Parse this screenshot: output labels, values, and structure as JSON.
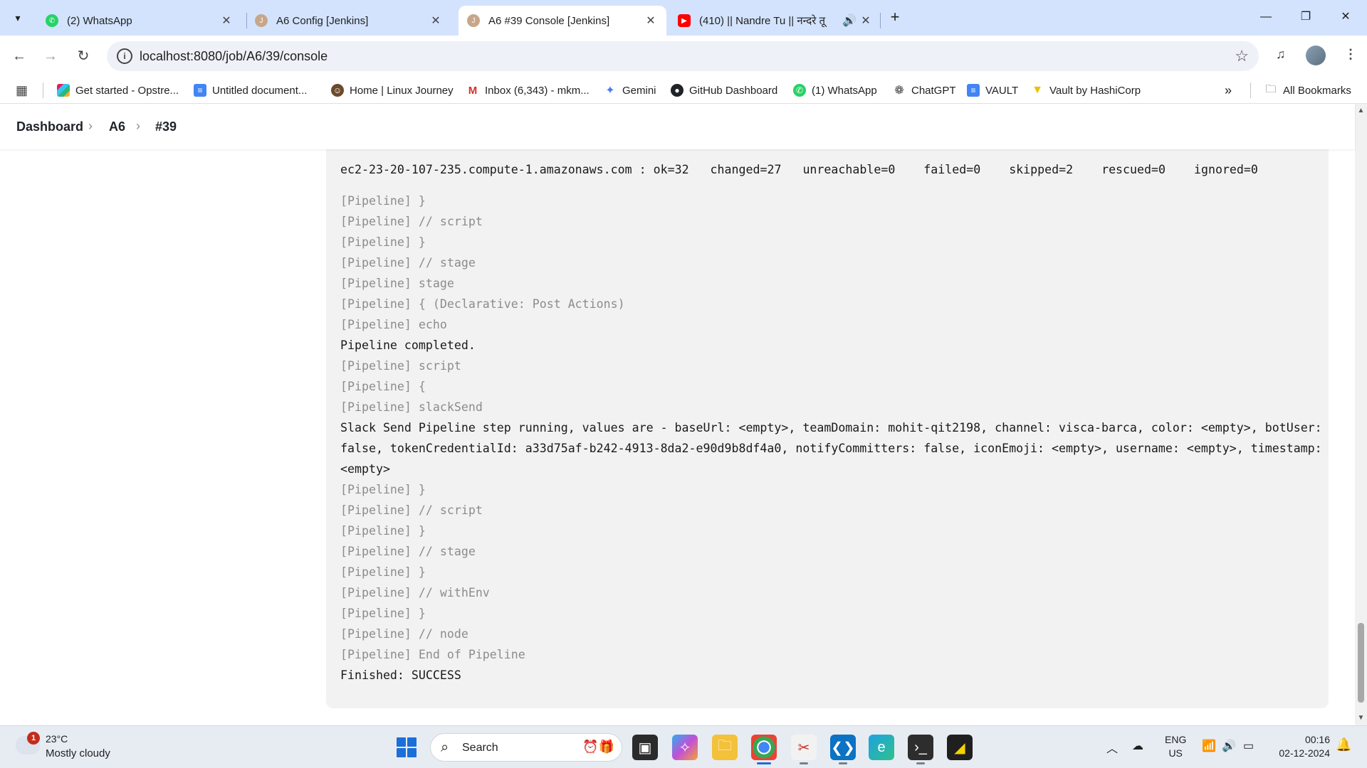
{
  "browser": {
    "tabs": [
      {
        "title": "(2) WhatsApp",
        "icon": "whatsapp-icon"
      },
      {
        "title": "A6 Config [Jenkins]",
        "icon": "jenkins-icon"
      },
      {
        "title": "A6 #39 Console [Jenkins]",
        "icon": "jenkins-icon",
        "active": true
      },
      {
        "title": "(410) || Nandre Tu || नन्दरे तू",
        "icon": "youtube-icon"
      }
    ],
    "url": "localhost:8080/job/A6/39/console",
    "bookmarks": [
      "Get started - Opstre...",
      "Untitled document...",
      "Home | Linux Journey",
      "Inbox (6,343) - mkm...",
      "Gemini",
      "GitHub Dashboard",
      "(1) WhatsApp",
      "ChatGPT",
      "VAULT",
      "Vault by HashiCorp"
    ],
    "all_bookmarks": "All Bookmarks",
    "more_glyph": "»"
  },
  "breadcrumb": {
    "items": [
      "Dashboard",
      "A6",
      "#39"
    ],
    "sep": "›"
  },
  "console": {
    "recap": {
      "host": "ec2-23-20-107-235.compute-1.amazonaws.com",
      "colon": ":",
      "ok": "ok=32",
      "changed": "changed=27",
      "unreachable": "unreachable=0",
      "failed": "failed=0",
      "skipped": "skipped=2",
      "rescued": "rescued=0",
      "ignored": "ignored=0"
    },
    "lines": [
      {
        "text": "[Pipeline] }",
        "dim": true
      },
      {
        "text": "[Pipeline] // script",
        "dim": true
      },
      {
        "text": "[Pipeline] }",
        "dim": true
      },
      {
        "text": "[Pipeline] // stage",
        "dim": true
      },
      {
        "text": "[Pipeline] stage",
        "dim": true
      },
      {
        "text": "[Pipeline] { (Declarative: Post Actions)",
        "dim": true
      },
      {
        "text": "[Pipeline] echo",
        "dim": true
      },
      {
        "text": "Pipeline completed.",
        "dim": false
      },
      {
        "text": "[Pipeline] script",
        "dim": true
      },
      {
        "text": "[Pipeline] {",
        "dim": true
      },
      {
        "text": "[Pipeline] slackSend",
        "dim": true
      },
      {
        "text": "Slack Send Pipeline step running, values are - baseUrl: <empty>, teamDomain: mohit-qit2198, channel: visca-barca, color: <empty>, botUser:",
        "dim": false
      },
      {
        "text": "false, tokenCredentialId: a33d75af-b242-4913-8da2-e90d9b8df4a0, notifyCommitters: false, iconEmoji: <empty>, username: <empty>, timestamp:",
        "dim": false
      },
      {
        "text": "<empty>",
        "dim": false
      },
      {
        "text": "[Pipeline] }",
        "dim": true
      },
      {
        "text": "[Pipeline] // script",
        "dim": true
      },
      {
        "text": "[Pipeline] }",
        "dim": true
      },
      {
        "text": "[Pipeline] // stage",
        "dim": true
      },
      {
        "text": "[Pipeline] }",
        "dim": true
      },
      {
        "text": "[Pipeline] // withEnv",
        "dim": true
      },
      {
        "text": "[Pipeline] }",
        "dim": true
      },
      {
        "text": "[Pipeline] // node",
        "dim": true
      },
      {
        "text": "[Pipeline] End of Pipeline",
        "dim": true
      },
      {
        "text": "Finished: SUCCESS",
        "dim": false
      }
    ]
  },
  "taskbar": {
    "weather": {
      "temp": "23°C",
      "desc": "Mostly cloudy",
      "badge": "1"
    },
    "search_label": "Search",
    "lang": [
      "ENG",
      "US"
    ],
    "time": "00:16",
    "date": "02-12-2024"
  },
  "colors": {
    "tabstrip": "#d3e3fd",
    "console_bg": "#f2f2f2",
    "dim_text": "#8c8c8c",
    "accent": "#1a6fd9"
  }
}
